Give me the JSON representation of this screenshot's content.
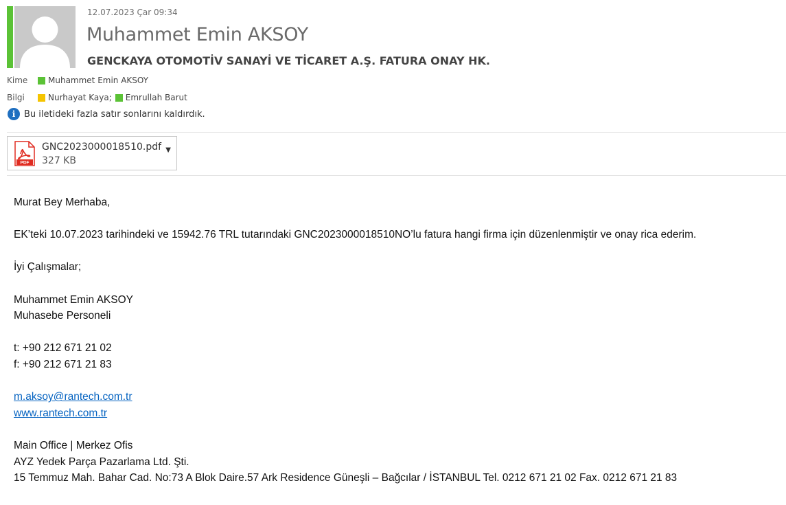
{
  "email": {
    "timestamp": "12.07.2023 Çar 09:34",
    "sender": "Muhammet Emin AKSOY",
    "subject": "GENCKAYA OTOMOTİV SANAYİ VE TİCARET A.Ş. FATURA ONAY HK.",
    "to_label": "Kime",
    "to": [
      {
        "name": "Muhammet Emin AKSOY",
        "presence_color": "#5bc236"
      }
    ],
    "cc_label": "Bilgi",
    "cc": [
      {
        "name": "Nurhayat Kaya;",
        "presence_color": "#f5c400"
      },
      {
        "name": "Emrullah Barut",
        "presence_color": "#5bc236"
      }
    ],
    "info_message": "Bu iletideki fazla satır sonlarını kaldırdık.",
    "info_icon": "info-icon",
    "attachment": {
      "filename": "GNC2023000018510.pdf",
      "size": "327 KB",
      "icon": "pdf-file-icon"
    }
  },
  "body": {
    "greeting": "Murat Bey Merhaba,",
    "paragraph": "EK’teki 10.07.2023 tarihindeki ve 15942.76 TRL tutarındaki GNC2023000018510NO’lu fatura hangi firma için düzenlenmiştir ve onay rica ederim.",
    "closing": "İyi Çalışmalar;",
    "signature": {
      "name": "Muhammet Emin AKSOY",
      "title": "Muhasebe Personeli",
      "phone": "t: +90 212 671 21 02",
      "fax": "f: +90 212 671 21 83",
      "email": "m.aksoy@rantech.com.tr",
      "website": "www.rantech.com.tr",
      "office": "Main Office | Merkez Ofis",
      "company": "AYZ Yedek Parça Pazarlama Ltd. Şti.",
      "address": "15 Temmuz Mah. Bahar Cad. No:73 A Blok Daire.57 Ark Residence Güneşli – Bağcılar / İSTANBUL Tel. 0212 671 21 02  Fax. 0212 671 21 83"
    }
  },
  "colors": {
    "presence_available": "#5bc236",
    "presence_away": "#f5c400",
    "link": "#0563c1",
    "info_icon": "#1f6fc0",
    "pdf_red": "#e02b20"
  }
}
